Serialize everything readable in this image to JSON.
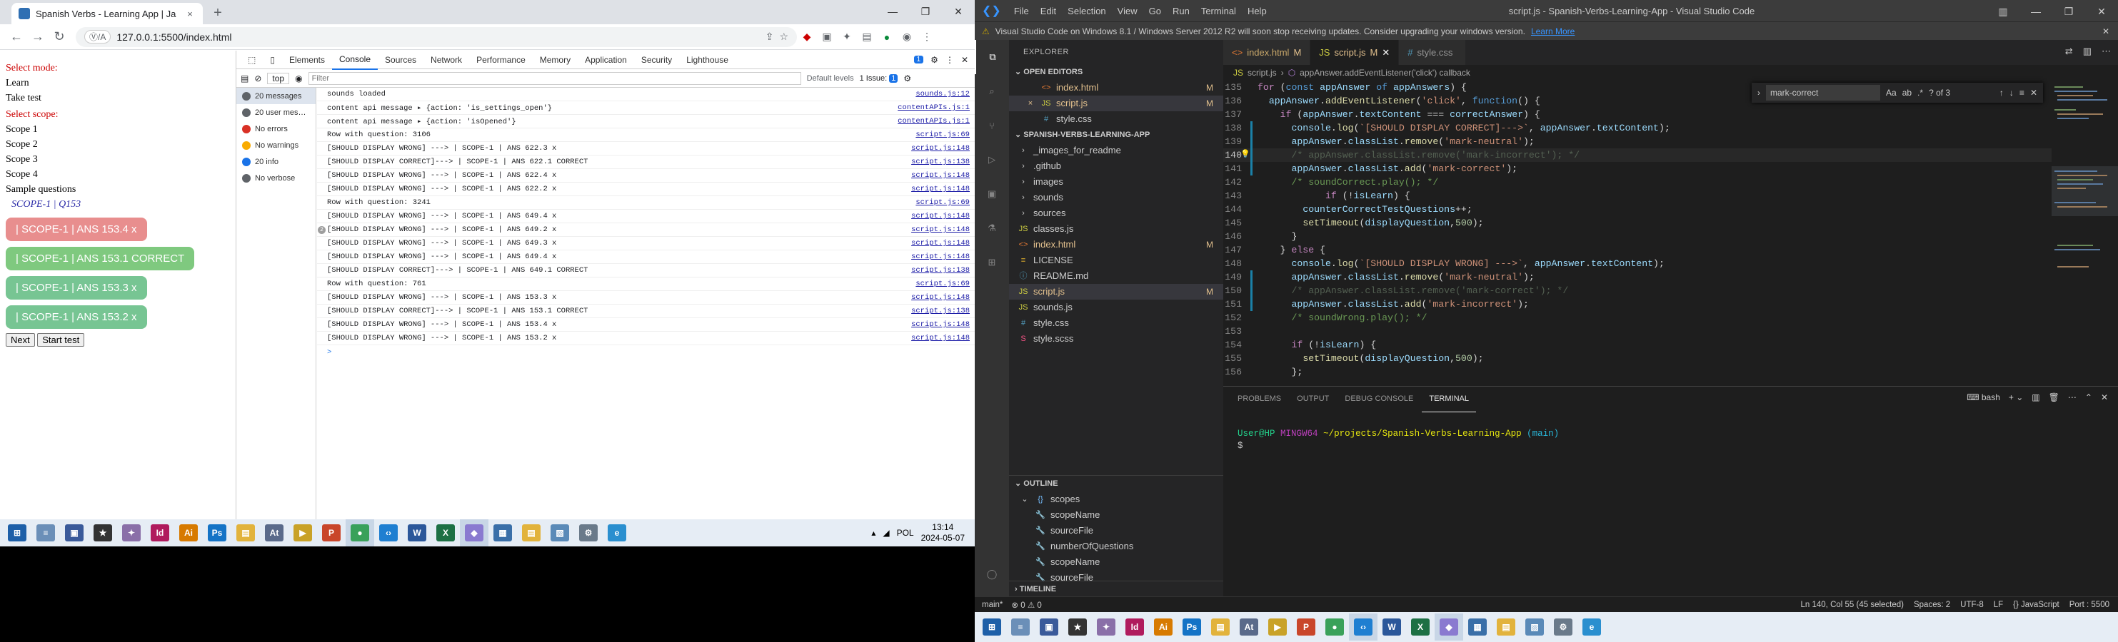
{
  "chrome": {
    "tab_title": "Spanish Verbs - Learning App | Ja",
    "tab_close": "×",
    "new_tab": "+",
    "address": "127.0.0.1:5500/index.html",
    "site_chip": "Ⓥ/A",
    "page": {
      "select_mode": "Select mode:",
      "modes": [
        "Learn",
        "Take test"
      ],
      "select_scope": "Select scope:",
      "scopes": [
        "Scope 1",
        "Scope 2",
        "Scope 3",
        "Scope 4",
        "Sample questions"
      ],
      "question": "SCOPE-1 | Q153",
      "answers": [
        {
          "label": "| SCOPE-1 | ANS 153.4 x",
          "state": "wrong"
        },
        {
          "label": "| SCOPE-1 | ANS 153.1 CORRECT",
          "state": "correct"
        },
        {
          "label": "| SCOPE-1 | ANS 153.3 x",
          "state": "neutral"
        },
        {
          "label": "| SCOPE-1 | ANS 153.2 x",
          "state": "neutral"
        }
      ],
      "next_button": "Next",
      "start_test_button": "Start test"
    },
    "devtools": {
      "tabs": [
        "Elements",
        "Console",
        "Sources",
        "Network",
        "Performance",
        "Memory",
        "Application",
        "Security",
        "Lighthouse"
      ],
      "active_tab": "Console",
      "issues_badge": "1",
      "context": "top",
      "filter_placeholder": "Filter",
      "levels": "Default levels",
      "issue_count": "1 Issue: ",
      "sidebar": [
        {
          "label": "20 messages",
          "color": "#5f6368"
        },
        {
          "label": "20 user mes…",
          "color": "#5f6368"
        },
        {
          "label": "No errors",
          "color": "#d93025"
        },
        {
          "label": "No warnings",
          "color": "#f9ab00"
        },
        {
          "label": "20 info",
          "color": "#1a73e8"
        },
        {
          "label": "No verbose",
          "color": "#5f6368"
        }
      ],
      "logs": [
        {
          "msg": "sounds loaded",
          "src": "sounds.js:12"
        },
        {
          "msg": "content api message ▸ {action: 'is_settings_open'}",
          "src": "contentAPIs.js:1"
        },
        {
          "msg": "content api message ▸ {action: 'isOpened'}",
          "src": "contentAPIs.js:1"
        },
        {
          "msg": "Row with question: 3106",
          "src": "script.js:69"
        },
        {
          "msg": "[SHOULD DISPLAY WRONG] ---> | SCOPE-1 | ANS 622.3 x",
          "src": "script.js:148"
        },
        {
          "msg": "[SHOULD DISPLAY CORRECT]---> | SCOPE-1 | ANS 622.1 CORRECT",
          "src": "script.js:138"
        },
        {
          "msg": "[SHOULD DISPLAY WRONG] ---> | SCOPE-1 | ANS 622.4 x",
          "src": "script.js:148"
        },
        {
          "msg": "[SHOULD DISPLAY WRONG] ---> | SCOPE-1 | ANS 622.2 x",
          "src": "script.js:148"
        },
        {
          "msg": "Row with question: 3241",
          "src": "script.js:69"
        },
        {
          "msg": "[SHOULD DISPLAY WRONG] ---> | SCOPE-1 | ANS 649.4 x",
          "src": "script.js:148"
        },
        {
          "msg": "[SHOULD DISPLAY WRONG] ---> | SCOPE-1 | ANS 649.2 x",
          "src": "script.js:148",
          "badge": "2"
        },
        {
          "msg": "[SHOULD DISPLAY WRONG] ---> | SCOPE-1 | ANS 649.3 x",
          "src": "script.js:148"
        },
        {
          "msg": "[SHOULD DISPLAY WRONG] ---> | SCOPE-1 | ANS 649.4 x",
          "src": "script.js:148"
        },
        {
          "msg": "[SHOULD DISPLAY CORRECT]---> | SCOPE-1 | ANS 649.1 CORRECT",
          "src": "script.js:138"
        },
        {
          "msg": "Row with question: 761",
          "src": "script.js:69"
        },
        {
          "msg": "[SHOULD DISPLAY WRONG] ---> | SCOPE-1 | ANS 153.3 x",
          "src": "script.js:148"
        },
        {
          "msg": "[SHOULD DISPLAY CORRECT]---> | SCOPE-1 | ANS 153.1 CORRECT",
          "src": "script.js:138"
        },
        {
          "msg": "[SHOULD DISPLAY WRONG] ---> | SCOPE-1 | ANS 153.4 x",
          "src": "script.js:148"
        },
        {
          "msg": "[SHOULD DISPLAY WRONG] ---> | SCOPE-1 | ANS 153.2 x",
          "src": "script.js:148"
        }
      ],
      "prompt": ">"
    }
  },
  "left_taskbar": {
    "apps": [
      {
        "name": "start",
        "label": "⊞",
        "color": "#1d5fa8"
      },
      {
        "name": "notepad",
        "label": "≡",
        "color": "#6b8fb8"
      },
      {
        "name": "save",
        "label": "▣",
        "color": "#3a5a9a"
      },
      {
        "name": "star-app",
        "label": "★",
        "color": "#333"
      },
      {
        "name": "paint",
        "label": "✦",
        "color": "#8a6fa8"
      },
      {
        "name": "indesign",
        "label": "Id",
        "color": "#b01b5d"
      },
      {
        "name": "illustrator",
        "label": "Ai",
        "color": "#d77a00"
      },
      {
        "name": "photoshop",
        "label": "Ps",
        "color": "#1473c6"
      },
      {
        "name": "explorer",
        "label": "▤",
        "color": "#e2b33c"
      },
      {
        "name": "app-at",
        "label": "At",
        "color": "#5a6a8a"
      },
      {
        "name": "media",
        "label": "▶",
        "color": "#c9a227"
      },
      {
        "name": "powerpoint",
        "label": "P",
        "color": "#c9462a"
      },
      {
        "name": "chrome",
        "label": "●",
        "color": "#3aa15a"
      },
      {
        "name": "vscode",
        "label": "‹›",
        "color": "#1f7fd1"
      },
      {
        "name": "word",
        "label": "W",
        "color": "#2b579a"
      },
      {
        "name": "excel",
        "label": "X",
        "color": "#1d7044"
      },
      {
        "name": "vpn",
        "label": "◆",
        "color": "#8a7ad0"
      },
      {
        "name": "photos",
        "label": "▦",
        "color": "#3a6fa8"
      },
      {
        "name": "folder",
        "label": "▤",
        "color": "#e2b33c"
      },
      {
        "name": "notes",
        "label": "▧",
        "color": "#5a8ab8"
      },
      {
        "name": "settings",
        "label": "⚙",
        "color": "#6a7a8a"
      },
      {
        "name": "edge",
        "label": "e",
        "color": "#2a8fcf"
      }
    ],
    "lang": "POL",
    "time": "13:14",
    "date": "2024-05-07"
  },
  "vscode": {
    "menu": [
      "File",
      "Edit",
      "Selection",
      "View",
      "Go",
      "Run",
      "Terminal",
      "Help"
    ],
    "title": "script.js - Spanish-Verbs-Learning-App - Visual Studio Code",
    "banner": "Visual Studio Code on Windows 8.1 / Windows Server 2012 R2 will soon stop receiving updates. Consider upgrading your windows version.",
    "banner_link": "Learn More",
    "explorer": "EXPLORER",
    "open_editors": "OPEN EDITORS",
    "open_files": [
      {
        "name": "index.html",
        "mark": "M",
        "icon": "<>",
        "close": ""
      },
      {
        "name": "script.js",
        "mark": "M",
        "icon": "JS",
        "close": "×"
      },
      {
        "name": "style.css",
        "mark": "",
        "icon": "#",
        "close": ""
      }
    ],
    "project": "SPANISH-VERBS-LEARNING-APP",
    "files": [
      {
        "name": "_images_for_readme",
        "kind": "folder",
        "mark": ""
      },
      {
        "name": ".github",
        "kind": "folder",
        "mark": ""
      },
      {
        "name": "images",
        "kind": "folder",
        "mark": ""
      },
      {
        "name": "sounds",
        "kind": "folder",
        "mark": ""
      },
      {
        "name": "sources",
        "kind": "folder",
        "mark": ""
      },
      {
        "name": "classes.js",
        "kind": "js",
        "mark": ""
      },
      {
        "name": "index.html",
        "kind": "html",
        "mark": "M"
      },
      {
        "name": "LICENSE",
        "kind": "txt",
        "mark": ""
      },
      {
        "name": "README.md",
        "kind": "md",
        "mark": ""
      },
      {
        "name": "script.js",
        "kind": "js",
        "mark": "M"
      },
      {
        "name": "sounds.js",
        "kind": "js",
        "mark": ""
      },
      {
        "name": "style.css",
        "kind": "css",
        "mark": ""
      },
      {
        "name": "style.scss",
        "kind": "scss",
        "mark": ""
      }
    ],
    "outline": "OUTLINE",
    "outline_root": "scopes",
    "outline_items": [
      "scopeName",
      "sourceFile",
      "numberOfQuestions",
      "scopeName",
      "sourceFile"
    ],
    "timeline": "TIMELINE",
    "tabs": [
      {
        "name": "index.html",
        "mark": "M",
        "active": false
      },
      {
        "name": "script.js",
        "mark": "M",
        "active": true
      },
      {
        "name": "style.css",
        "mark": "",
        "active": false
      }
    ],
    "breadcrumb": [
      "script.js",
      "appAnswer.addEventListener('click') callback"
    ],
    "find": {
      "query": "mark-correct",
      "result": "? of 3"
    },
    "panel_tabs": [
      "PROBLEMS",
      "OUTPUT",
      "DEBUG CONSOLE",
      "TERMINAL"
    ],
    "active_panel": "TERMINAL",
    "terminal_shell": "bash",
    "terminal_user": "User@HP",
    "terminal_env": "MINGW64",
    "terminal_path": "~/projects/Spanish-Verbs-Learning-App",
    "terminal_branch": "(main)",
    "terminal_prompt": "$",
    "status_left": [
      "main*",
      "⊗ 0 ⚠ 0"
    ],
    "status_right": [
      "Ln 140, Col 55 (45 selected)",
      "Spaces: 2",
      "UTF-8",
      "LF",
      "{} JavaScript",
      "Port : 5500"
    ]
  },
  "code_lines": [
    {
      "n": "135",
      "html": "<span class=\"kw\">for</span> <span class=\"pl\">(</span><span class=\"kb\">const</span> <span class=\"vr\">appAnswer</span> <span class=\"kb\">of</span> <span class=\"vr\">appAnswers</span><span class=\"pl\">) {</span>"
    },
    {
      "n": "136",
      "html": "  <span class=\"vr\">appAnswer</span><span class=\"pl\">.</span><span class=\"fn\">addEventListener</span><span class=\"pl\">(</span><span class=\"st\">'click'</span><span class=\"pl\">, </span><span class=\"kb\">function</span><span class=\"pl\">() {</span>"
    },
    {
      "n": "137",
      "html": "    <span class=\"kw\">if</span> <span class=\"pl\">(</span><span class=\"vr\">appAnswer</span><span class=\"pl\">.</span><span class=\"vr\">textContent</span> <span class=\"pl\">===</span> <span class=\"vr\">correctAnswer</span><span class=\"pl\">) {</span>"
    },
    {
      "n": "138",
      "html": "      <span class=\"vr\">console</span><span class=\"pl\">.</span><span class=\"fn\">log</span><span class=\"pl\">(</span><span class=\"st\">`[SHOULD DISPLAY CORRECT]---&gt;`</span><span class=\"pl\">, </span><span class=\"vr\">appAnswer</span><span class=\"pl\">.</span><span class=\"vr\">textContent</span><span class=\"pl\">);</span>"
    },
    {
      "n": "139",
      "html": "      <span class=\"vr\">appAnswer</span><span class=\"pl\">.</span><span class=\"vr\">classList</span><span class=\"pl\">.</span><span class=\"fn\">remove</span><span class=\"pl\">(</span><span class=\"st\">'mark-neutral'</span><span class=\"pl\">);</span>"
    },
    {
      "n": "140",
      "html": "      <span class=\"cm-dim\">/* appAnswer.classList.remove('mark-incorrect'); */</span>",
      "cur": true
    },
    {
      "n": "141",
      "html": "      <span class=\"vr\">appAnswer</span><span class=\"pl\">.</span><span class=\"vr\">classList</span><span class=\"pl\">.</span><span class=\"fn\">add</span><span class=\"pl\">(</span><span class=\"st\">'mark-correct'</span><span class=\"pl\">);</span>"
    },
    {
      "n": "142",
      "html": "      <span class=\"cm\">/* soundCorrect.play(); */</span>"
    },
    {
      "n": "143",
      "html": "            <span class=\"kw\">if</span> <span class=\"pl\">(!</span><span class=\"vr\">isLearn</span><span class=\"pl\">) {</span>"
    },
    {
      "n": "144",
      "html": "        <span class=\"vr\">counterCorrectTestQuestions</span><span class=\"pl\">++;</span>"
    },
    {
      "n": "145",
      "html": "        <span class=\"fn\">setTimeout</span><span class=\"pl\">(</span><span class=\"vr\">displayQuestion</span><span class=\"pl\">,</span><span class=\"nu\">500</span><span class=\"pl\">);</span>"
    },
    {
      "n": "146",
      "html": "      <span class=\"pl\">}</span>"
    },
    {
      "n": "147",
      "html": "    <span class=\"pl\">} </span><span class=\"kw\">else</span><span class=\"pl\"> {</span>"
    },
    {
      "n": "148",
      "html": "      <span class=\"vr\">console</span><span class=\"pl\">.</span><span class=\"fn\">log</span><span class=\"pl\">(</span><span class=\"st\">`[SHOULD DISPLAY WRONG] ---&gt;`</span><span class=\"pl\">, </span><span class=\"vr\">appAnswer</span><span class=\"pl\">.</span><span class=\"vr\">textContent</span><span class=\"pl\">);</span>"
    },
    {
      "n": "149",
      "html": "      <span class=\"vr\">appAnswer</span><span class=\"pl\">.</span><span class=\"vr\">classList</span><span class=\"pl\">.</span><span class=\"fn\">remove</span><span class=\"pl\">(</span><span class=\"st\">'mark-neutral'</span><span class=\"pl\">);</span>"
    },
    {
      "n": "150",
      "html": "      <span class=\"cm-dim\">/* appAnswer.classList.remove('mark-correct'); */</span>"
    },
    {
      "n": "151",
      "html": "      <span class=\"vr\">appAnswer</span><span class=\"pl\">.</span><span class=\"vr\">classList</span><span class=\"pl\">.</span><span class=\"fn\">add</span><span class=\"pl\">(</span><span class=\"st\">'mark-incorrect'</span><span class=\"pl\">);</span>"
    },
    {
      "n": "152",
      "html": "      <span class=\"cm\">/* soundWrong.play(); */</span>"
    },
    {
      "n": "153",
      "html": ""
    },
    {
      "n": "154",
      "html": "      <span class=\"kw\">if</span> <span class=\"pl\">(!</span><span class=\"vr\">isLearn</span><span class=\"pl\">) {</span>"
    },
    {
      "n": "155",
      "html": "        <span class=\"fn\">setTimeout</span><span class=\"pl\">(</span><span class=\"vr\">displayQuestion</span><span class=\"pl\">,</span><span class=\"nu\">500</span><span class=\"pl\">);</span>"
    },
    {
      "n": "156",
      "html": "      <span class=\"pl\">};</span>"
    }
  ],
  "right_taskbar": {
    "apps": [
      "start",
      "notepad",
      "save",
      "star-app",
      "paint",
      "indesign",
      "illustrator",
      "photoshop",
      "explorer",
      "app-at",
      "media",
      "powerpoint",
      "chrome",
      "vscode",
      "word",
      "excel",
      "vpn",
      "photos",
      "folder",
      "notes",
      "settings",
      "edge"
    ]
  }
}
